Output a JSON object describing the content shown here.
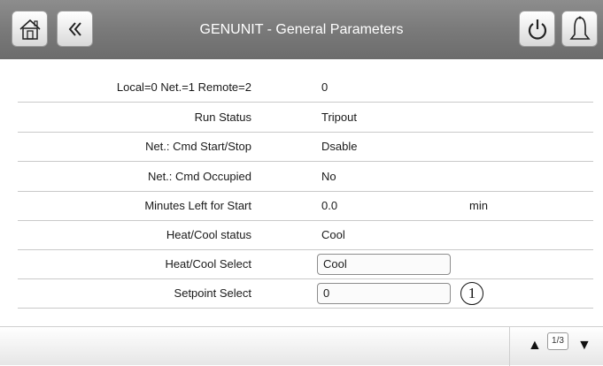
{
  "header": {
    "title": "GENUNIT - General Parameters",
    "home_icon": "home-icon",
    "back_icon": "double-chevron-left-icon",
    "power_icon": "power-icon",
    "alarm_icon": "bell-icon"
  },
  "rows": [
    {
      "label": "Local=0 Net.=1 Remote=2",
      "value": "0"
    },
    {
      "label": "Run Status",
      "value": "Tripout"
    },
    {
      "label": "Net.: Cmd Start/Stop",
      "value": "Dsable"
    },
    {
      "label": "Net.: Cmd Occupied",
      "value": "No"
    },
    {
      "label": "Minutes Left for Start",
      "value": "0.0",
      "unit": "min"
    },
    {
      "label": "Heat/Cool status",
      "value": "Cool"
    },
    {
      "label": "Heat/Cool Select",
      "value": "Cool"
    },
    {
      "label": "Setpoint Select",
      "value": "0",
      "callout": "1"
    }
  ],
  "footer": {
    "page": "1/3",
    "up_icon": "triangle-up-icon",
    "down_icon": "triangle-down-icon"
  }
}
